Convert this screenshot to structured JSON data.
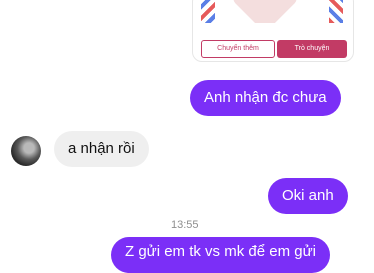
{
  "shared_card": {
    "button_more": "Chuyển thêm",
    "button_chat": "Trò chuyện"
  },
  "messages": [
    {
      "side": "out",
      "text": "Anh nhận đc chưa"
    },
    {
      "side": "in",
      "text": "a nhận rồi"
    },
    {
      "side": "out",
      "text": "Oki anh"
    },
    {
      "side": "out",
      "text": "Z gửi em tk vs mk để em gửi"
    }
  ],
  "timestamp": "13:55",
  "colors": {
    "outgoing_bubble": "#7b2ff7",
    "incoming_bubble": "#efefef",
    "card_accent": "#c23b65"
  }
}
